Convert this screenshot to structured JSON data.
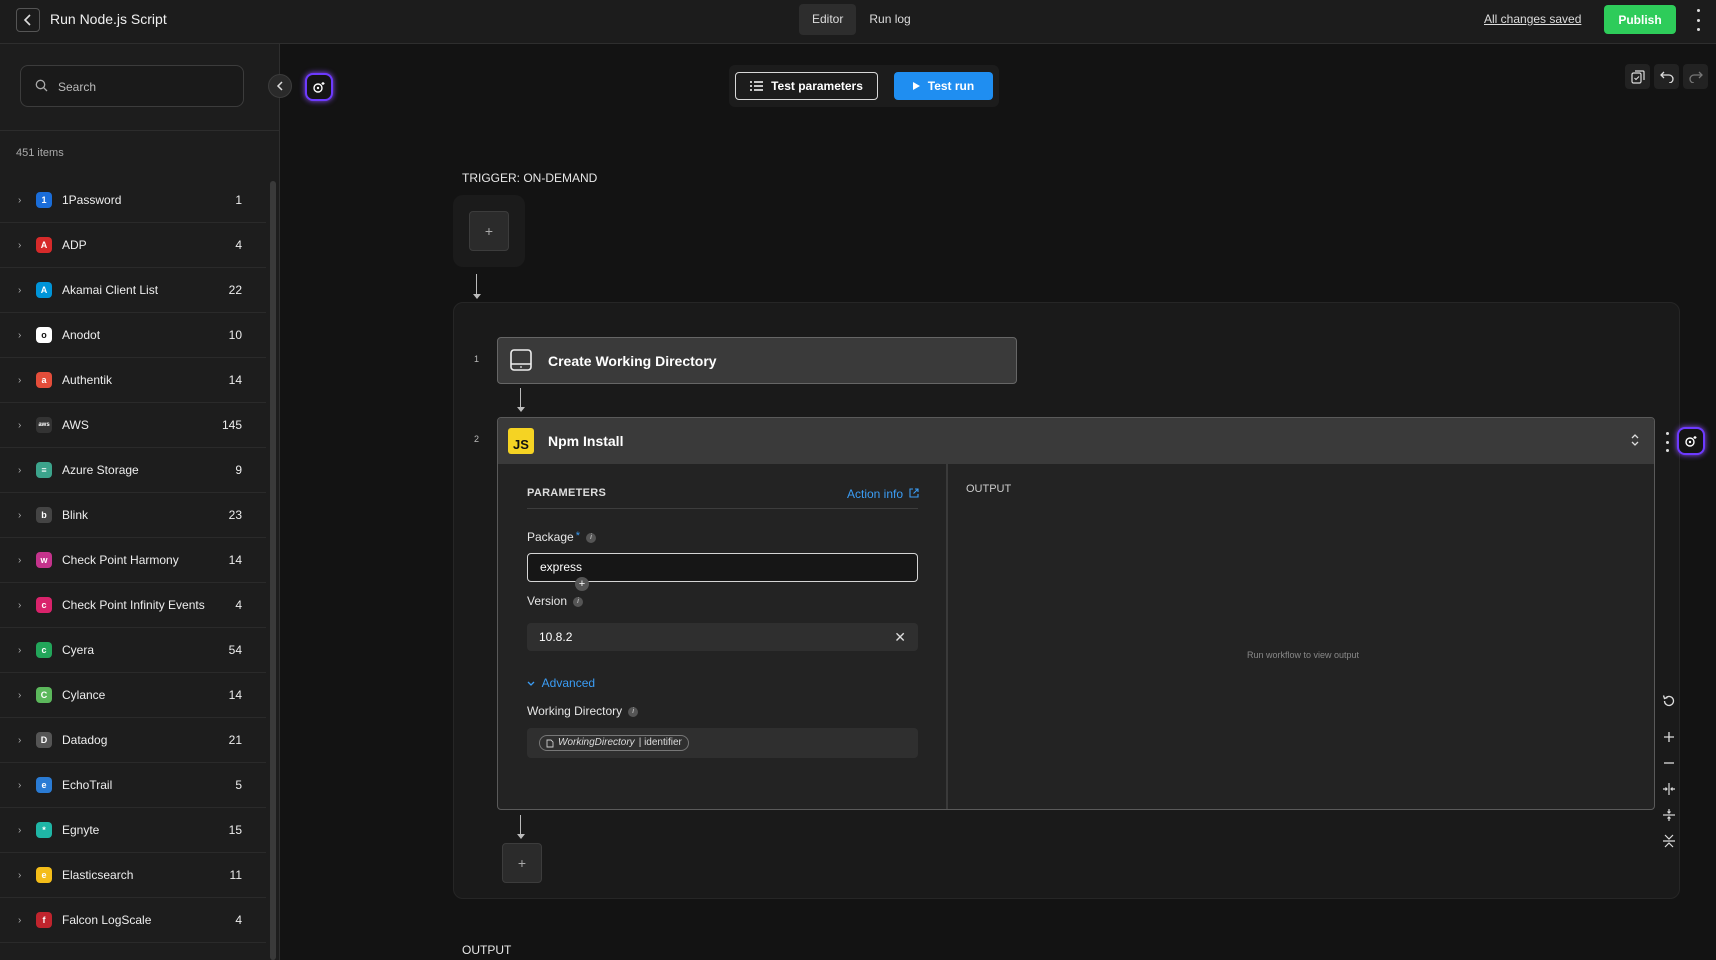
{
  "header": {
    "title": "Run Node.js Script",
    "tabs": [
      {
        "label": "Editor",
        "active": true
      },
      {
        "label": "Run log",
        "active": false
      }
    ],
    "saved_status": "All changes saved",
    "publish_label": "Publish",
    "publish_color": "#2ecc5a"
  },
  "sidebar": {
    "search_placeholder": "Search",
    "item_count": "451 items",
    "items": [
      {
        "label": "1Password",
        "count": "1",
        "logo_color": "#1a6dd9",
        "glyph": "1"
      },
      {
        "label": "ADP",
        "count": "4",
        "logo_color": "#d62a2a",
        "glyph": "A"
      },
      {
        "label": "Akamai Client List",
        "count": "22",
        "logo_color": "#0095d9",
        "glyph": "A"
      },
      {
        "label": "Anodot",
        "count": "10",
        "logo_color": "#ffffff",
        "glyph": "o"
      },
      {
        "label": "Authentik",
        "count": "14",
        "logo_color": "#e44d3a",
        "glyph": "a"
      },
      {
        "label": "AWS",
        "count": "145",
        "logo_color": "#333333",
        "glyph": "aws"
      },
      {
        "label": "Azure Storage",
        "count": "9",
        "logo_color": "#3ca48c",
        "glyph": "≡"
      },
      {
        "label": "Blink",
        "count": "23",
        "logo_color": "#444444",
        "glyph": "b"
      },
      {
        "label": "Check Point Harmony",
        "count": "14",
        "logo_color": "#c4338c",
        "glyph": "w"
      },
      {
        "label": "Check Point Infinity Events",
        "count": "4",
        "logo_color": "#d9236b",
        "glyph": "c"
      },
      {
        "label": "Cyera",
        "count": "54",
        "logo_color": "#22a65a",
        "glyph": "c"
      },
      {
        "label": "Cylance",
        "count": "14",
        "logo_color": "#5cb85c",
        "glyph": "C"
      },
      {
        "label": "Datadog",
        "count": "21",
        "logo_color": "#555555",
        "glyph": "D"
      },
      {
        "label": "EchoTrail",
        "count": "5",
        "logo_color": "#2a7bd4",
        "glyph": "e"
      },
      {
        "label": "Egnyte",
        "count": "15",
        "logo_color": "#1fb6a6",
        "glyph": "*"
      },
      {
        "label": "Elasticsearch",
        "count": "11",
        "logo_color": "#f4bd19",
        "glyph": "e"
      },
      {
        "label": "Falcon LogScale",
        "count": "4",
        "logo_color": "#c0242d",
        "glyph": "f"
      }
    ]
  },
  "toolbar": {
    "test_parameters_label": "Test parameters",
    "test_run_label": "Test run",
    "test_run_color": "#1f8ef1"
  },
  "workflow": {
    "trigger_label": "TRIGGER: ON-DEMAND",
    "output_label": "OUTPUT",
    "steps": [
      {
        "number": "1",
        "title": "Create Working Directory"
      },
      {
        "number": "2",
        "title": "Npm Install",
        "icon_text": "JS"
      }
    ],
    "params": {
      "section_title": "PARAMETERS",
      "action_info_label": "Action info",
      "package_label": "Package",
      "required_mark": "*",
      "package_value": "express",
      "version_label": "Version",
      "version_value": "10.8.2",
      "advanced_label": "Advanced",
      "working_dir_label": "Working Directory",
      "working_dir_chip_var": "WorkingDirectory",
      "working_dir_chip_field": "| identifier"
    },
    "output": {
      "title": "OUTPUT",
      "empty_text": "Run workflow to view output"
    }
  }
}
